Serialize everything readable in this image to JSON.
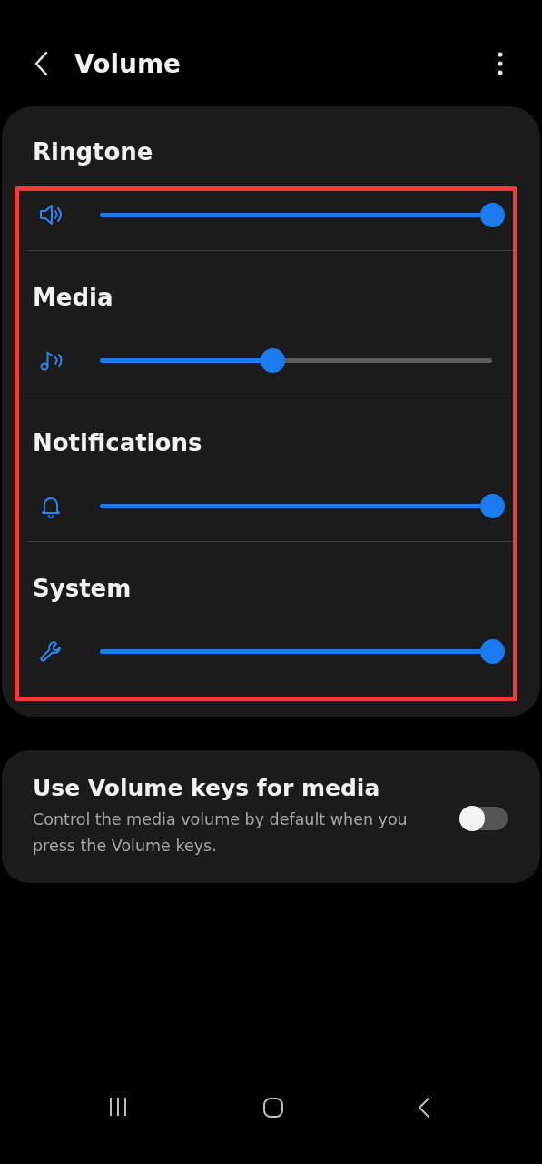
{
  "header": {
    "title": "Volume"
  },
  "volumes": [
    {
      "kind": "ringtone",
      "label": "Ringtone",
      "level": 1.0
    },
    {
      "kind": "media",
      "label": "Media",
      "level": 0.44
    },
    {
      "kind": "notifications",
      "label": "Notifications",
      "level": 1.0
    },
    {
      "kind": "system",
      "label": "System",
      "level": 1.0
    }
  ],
  "volume_keys": {
    "title": "Use Volume keys for media",
    "description": "Control the media volume by default when you press the Volume keys.",
    "on": false
  },
  "annotation": {
    "kind": "frame"
  }
}
